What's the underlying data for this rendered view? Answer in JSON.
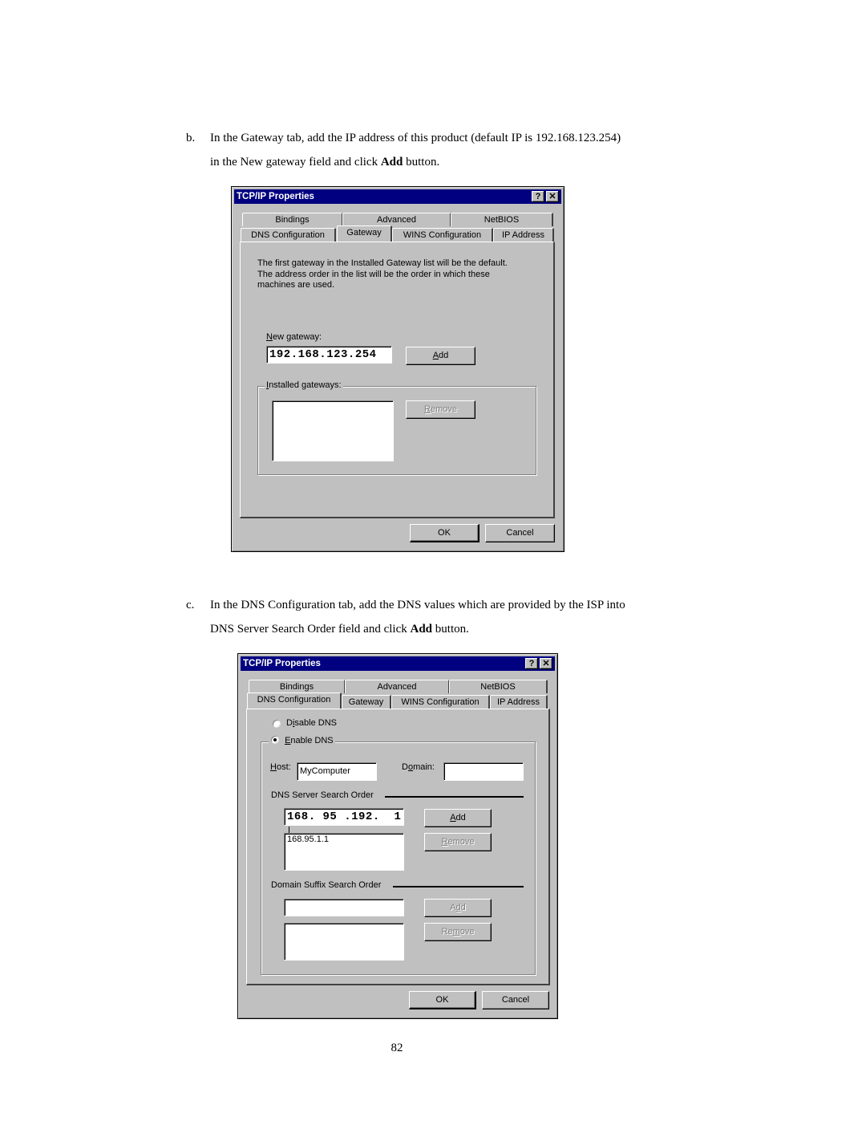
{
  "document": {
    "step_b": {
      "label": "b.",
      "line1": "In the Gateway tab, add the IP address of this product (default IP is 192.168.123.254)",
      "line2_pre": "in the New gateway field and click ",
      "line2_bold": "Add",
      "line2_post": " button."
    },
    "step_c": {
      "label": "c.",
      "line1": "In the DNS Configuration tab, add the DNS values which are provided by the ISP into",
      "line2_pre": "DNS Server Search Order field and click ",
      "line2_bold": "Add",
      "line2_post": " button."
    },
    "page_number": "82"
  },
  "dialog_gateway": {
    "title": "TCP/IP Properties",
    "help_icon": "?",
    "close_icon": "✕",
    "tabs_row1": [
      "Bindings",
      "Advanced",
      "NetBIOS"
    ],
    "tabs_row2": [
      "DNS Configuration",
      "Gateway",
      "WINS Configuration",
      "IP Address"
    ],
    "active_tab": "Gateway",
    "description_lines": [
      "The first gateway in the Installed Gateway list will be the default.",
      "The address order in the list will be the order in which these",
      "machines are used."
    ],
    "new_gateway_label_accel": "N",
    "new_gateway_label_rest": "ew gateway:",
    "new_gateway_value": "192.168.123.254",
    "add_accel": "A",
    "add_rest": "dd",
    "installed_label_accel": "I",
    "installed_label_rest": "nstalled gateways:",
    "installed_items": [],
    "remove_accel": "R",
    "remove_rest": "emove",
    "ok_label": "OK",
    "cancel_label": "Cancel"
  },
  "dialog_dns": {
    "title": "TCP/IP Properties",
    "help_icon": "?",
    "close_icon": "✕",
    "tabs_row1": [
      "Bindings",
      "Advanced",
      "NetBIOS"
    ],
    "tabs_row2": [
      "DNS Configuration",
      "Gateway",
      "WINS Configuration",
      "IP Address"
    ],
    "active_tab": "DNS Configuration",
    "disable_dns_pre": "D",
    "disable_dns_accel": "i",
    "disable_dns_rest": "sable DNS",
    "enable_dns_accel": "E",
    "enable_dns_rest": "nable DNS",
    "dns_mode": "enable",
    "host_label_accel": "H",
    "host_label_rest": "ost:",
    "host_value": "MyComputer",
    "domain_label_pre": "D",
    "domain_label_accel": "o",
    "domain_label_rest": "main:",
    "domain_value": "",
    "dns_server_order_label": "DNS Server Search Order",
    "dns_server_input": "168. 95 .192.  1",
    "dns_server_items": [
      "168.95.1.1"
    ],
    "add_accel": "A",
    "add_rest": "dd",
    "remove_accel": "R",
    "remove_rest": "emove",
    "domain_suffix_label": "Domain Suffix Search Order",
    "domain_suffix_input": "",
    "domain_suffix_items": [],
    "suffix_add_pre": "A",
    "suffix_add_accel": "d",
    "suffix_add_rest": "d",
    "suffix_remove_pre": "Re",
    "suffix_remove_accel": "m",
    "suffix_remove_rest": "ove",
    "ok_label": "OK",
    "cancel_label": "Cancel"
  }
}
